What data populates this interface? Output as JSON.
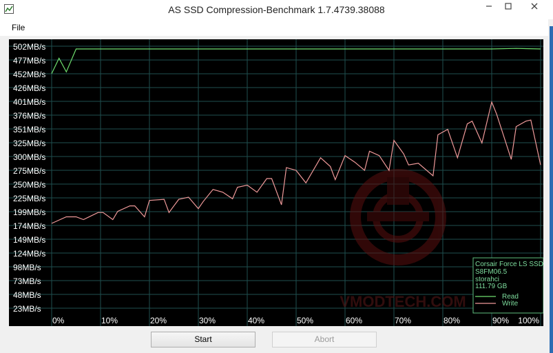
{
  "window": {
    "title": "AS SSD Compression-Benchmark 1.7.4739.38088"
  },
  "menu": {
    "file_label": "File"
  },
  "buttons": {
    "start_label": "Start",
    "abort_label": "Abort"
  },
  "device": {
    "model": "Corsair Force LS SSD",
    "firmware": "S8FM06.5",
    "driver": "storahci",
    "capacity": "111.79 GB"
  },
  "watermark": "VMODTECH.COM",
  "colors": {
    "read": "#6fe06f",
    "write": "#f09a9a",
    "grid": "#1f4f4f",
    "background": "#000000"
  },
  "chart_data": {
    "type": "line",
    "y_tick_labels": [
      "502MB/s",
      "477MB/s",
      "452MB/s",
      "426MB/s",
      "401MB/s",
      "376MB/s",
      "351MB/s",
      "325MB/s",
      "300MB/s",
      "275MB/s",
      "250MB/s",
      "225MB/s",
      "199MB/s",
      "174MB/s",
      "149MB/s",
      "124MB/s",
      "98MB/s",
      "73MB/s",
      "48MB/s",
      "23MB/s"
    ],
    "x_tick_labels": [
      "0%",
      "10%",
      "20%",
      "30%",
      "40%",
      "50%",
      "60%",
      "70%",
      "80%",
      "90%",
      "100%"
    ],
    "ylim": [
      23,
      502
    ],
    "xlim": [
      0,
      100
    ],
    "series": [
      {
        "name": "Read",
        "x": [
          0,
          1.5,
          3,
          5,
          7,
          10,
          20,
          30,
          40,
          50,
          60,
          70,
          80,
          90,
          95,
          100
        ],
        "values": [
          452,
          480,
          455,
          497,
          497,
          497,
          497,
          497,
          497,
          497,
          497,
          497,
          497,
          497,
          498,
          497
        ]
      },
      {
        "name": "Write",
        "x": [
          0,
          3,
          5,
          6.5,
          9.5,
          10.5,
          12.5,
          13.5,
          16,
          17,
          19,
          20,
          23,
          24,
          26,
          28,
          30,
          31,
          33,
          35,
          37,
          38,
          40,
          42,
          44,
          45,
          47,
          48,
          50,
          52,
          55,
          57,
          58,
          60,
          62,
          64,
          65,
          67,
          69,
          70,
          72,
          73,
          75,
          78,
          79,
          81,
          83,
          85,
          86,
          88,
          90,
          91,
          94,
          95,
          97,
          98,
          100
        ],
        "values": [
          178,
          190,
          190,
          185,
          198,
          198,
          185,
          200,
          210,
          210,
          190,
          220,
          222,
          198,
          222,
          226,
          205,
          218,
          240,
          235,
          223,
          244,
          248,
          235,
          260,
          260,
          212,
          280,
          275,
          252,
          298,
          282,
          258,
          302,
          290,
          275,
          310,
          302,
          275,
          330,
          305,
          285,
          288,
          265,
          340,
          350,
          298,
          360,
          365,
          325,
          400,
          378,
          295,
          355,
          365,
          367,
          285
        ]
      }
    ]
  }
}
